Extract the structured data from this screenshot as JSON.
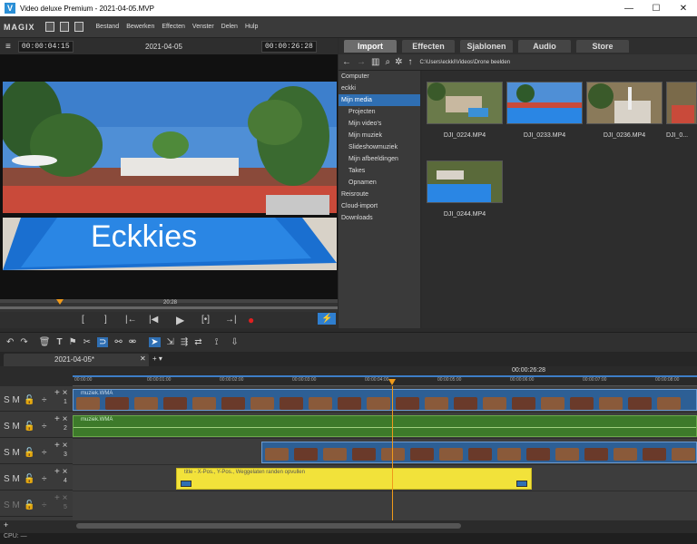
{
  "window": {
    "title": "Video deluxe Premium - 2021-04-05.MVP",
    "app_icon": "V"
  },
  "menu": {
    "logo": "MAGIX",
    "items": [
      "Bestand",
      "Bewerken",
      "Effecten",
      "Venster",
      "Delen",
      "Hulp"
    ]
  },
  "preview": {
    "timecode_left": "00:00:04:15",
    "project_date": "2021-04-05",
    "timecode_right": "00:00:26:28",
    "overlay_text": "Eckkies",
    "scrub_time": "20:28"
  },
  "transport": {
    "buttons": [
      "[",
      "]",
      "|←",
      "|◀",
      "▶",
      "[•]",
      "→|",
      "●",
      "⚡"
    ]
  },
  "media_tabs": [
    {
      "label": "Import",
      "active": true
    },
    {
      "label": "Effecten",
      "active": false
    },
    {
      "label": "Sjablonen",
      "active": false
    },
    {
      "label": "Audio",
      "active": false
    },
    {
      "label": "Store",
      "active": false
    }
  ],
  "path": "C:\\Users\\eckki\\Videos\\Drone beelden",
  "tree": [
    {
      "label": "Computer",
      "level": 0,
      "selected": false
    },
    {
      "label": "eckki",
      "level": 0,
      "selected": false
    },
    {
      "label": "Mijn media",
      "level": 0,
      "selected": true
    },
    {
      "label": "Projecten",
      "level": 1,
      "selected": false
    },
    {
      "label": "Mijn video's",
      "level": 1,
      "selected": false
    },
    {
      "label": "Mijn muziek",
      "level": 1,
      "selected": false
    },
    {
      "label": "Slideshowmuziek",
      "level": 1,
      "selected": false
    },
    {
      "label": "Mijn afbeeldingen",
      "level": 1,
      "selected": false
    },
    {
      "label": "Takes",
      "level": 1,
      "selected": false
    },
    {
      "label": "Opnamen",
      "level": 1,
      "selected": false
    },
    {
      "label": "Reisroute",
      "level": 0,
      "selected": false
    },
    {
      "label": "Cloud-import",
      "level": 0,
      "selected": false
    },
    {
      "label": "Downloads",
      "level": 0,
      "selected": false
    }
  ],
  "files": [
    {
      "name": "DJI_0224.MP4"
    },
    {
      "name": "DJI_0233.MP4"
    },
    {
      "name": "DJI_0236.MP4"
    },
    {
      "name": "DJI_0..."
    },
    {
      "name": "DJI_0244.MP4"
    }
  ],
  "timeline": {
    "project_tab": "2021-04-05*",
    "add_tab": "+ ▾",
    "ruler_time": "00:00:26:28",
    "ruler_ticks": [
      "00:00:00",
      "00:00:01:00",
      "00:00:02:00",
      "00:00:03:00",
      "00:00:04:00",
      "00:00:05:00",
      "00:00:06:00",
      "00:00:07:00",
      "00:00:08:00"
    ],
    "tracks": [
      {
        "number": "1",
        "clip_label": "muziek.WMA"
      },
      {
        "number": "2",
        "clip_label": "muziek.WMA"
      },
      {
        "number": "3",
        "clip_label": ""
      },
      {
        "number": "4",
        "clip_label": "title - X-Pos., Y-Pos., Weggelaten randen opvullen"
      },
      {
        "number": "5",
        "clip_label": ""
      }
    ],
    "track_controls": "S M",
    "title_clip_color": "#f2e23a",
    "audio_clip_color": "#4a8a34",
    "video_clip_color": "#3a6fa8"
  },
  "status": {
    "cpu": "CPU: —"
  }
}
